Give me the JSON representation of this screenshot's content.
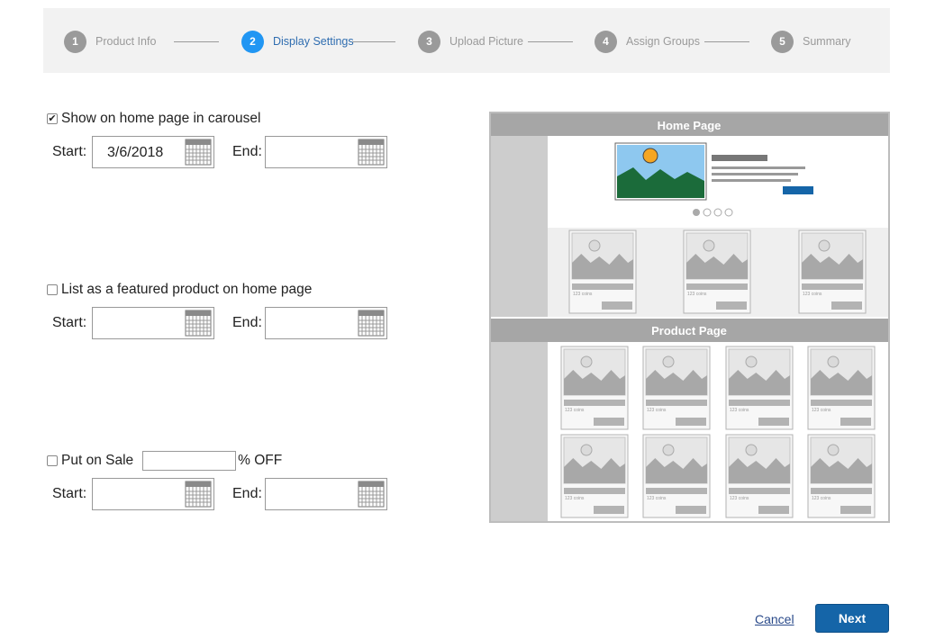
{
  "stepper": {
    "steps": [
      {
        "num": "1",
        "label": "Product Info"
      },
      {
        "num": "2",
        "label": "Display Settings"
      },
      {
        "num": "3",
        "label": "Upload Picture"
      },
      {
        "num": "4",
        "label": "Assign Groups"
      },
      {
        "num": "5",
        "label": "Summary"
      }
    ],
    "active_step": 2
  },
  "carousel": {
    "checked": true,
    "label": "Show on home page in carousel",
    "start_label": "Start:",
    "start_value": "3/6/2018",
    "end_label": "End:",
    "end_value": ""
  },
  "featured": {
    "checked": false,
    "label": "List as a featured product on home page",
    "start_label": "Start:",
    "start_value": "",
    "end_label": "End:",
    "end_value": ""
  },
  "sale": {
    "checked": false,
    "label": "Put on Sale",
    "percent_value": "",
    "percent_suffix": "% OFF",
    "start_label": "Start:",
    "start_value": "",
    "end_label": "End:",
    "end_value": ""
  },
  "preview": {
    "home_title": "Home Page",
    "product_title": "Product Page",
    "card_caption": "123 coins",
    "colors": {
      "header": "#a6a6a6",
      "sky": "#8ec8ef",
      "sun": "#f5a623",
      "hills": "#1b6b3a",
      "button": "#1565a8"
    }
  },
  "footer": {
    "cancel_label": "Cancel",
    "next_label": "Next"
  }
}
